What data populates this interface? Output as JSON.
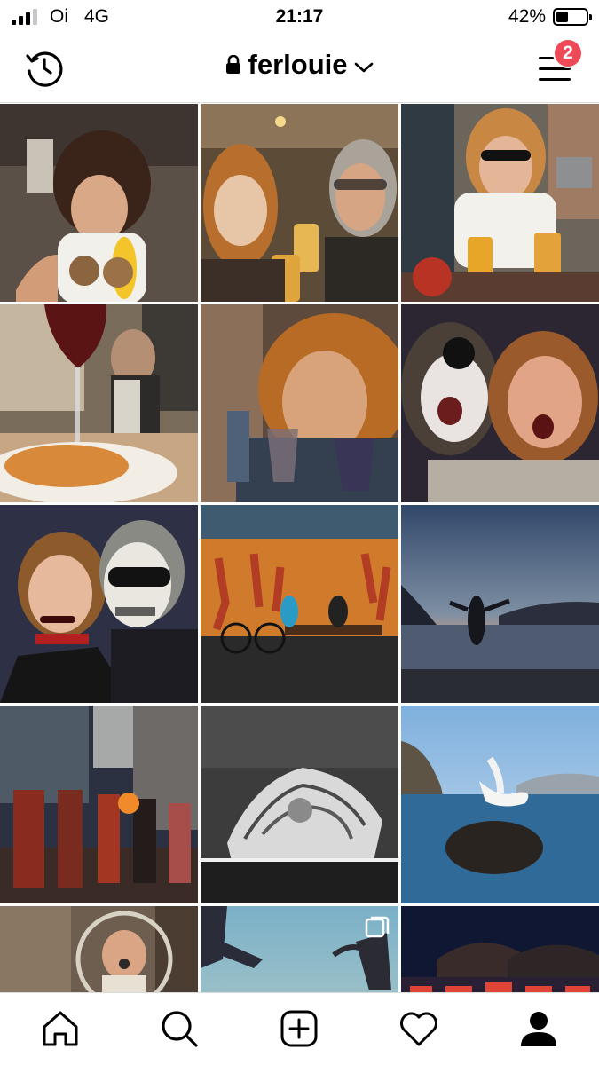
{
  "status_bar": {
    "carrier": "Oi",
    "network": "4G",
    "time": "21:17",
    "battery_text": "42%",
    "battery_level": 0.42,
    "signal_bars": 3
  },
  "header": {
    "username": "ferlouie",
    "notification_count": "2",
    "icons": [
      "history-icon",
      "lock-icon",
      "chevron-down-icon",
      "menu-icon"
    ]
  },
  "colors": {
    "badge": "#ed4956",
    "divider": "#dbdbdb"
  },
  "grid": {
    "posts": [
      {
        "name": "post-1-woman-holding-coconuts"
      },
      {
        "name": "post-2-couple-selfie-with-beer"
      },
      {
        "name": "post-3-woman-eating-with-drinks"
      },
      {
        "name": "post-4-wine-glass-and-food"
      },
      {
        "name": "post-5-woman-with-wine-glasses"
      },
      {
        "name": "post-6-halloween-skull-makeup-selfie"
      },
      {
        "name": "post-7-halloween-costume-couple"
      },
      {
        "name": "post-8-bicycle-orange-wall-mural"
      },
      {
        "name": "post-9-silhouette-at-sunset-beach"
      },
      {
        "name": "post-10-street-parade-performers"
      },
      {
        "name": "post-11-black-and-white-graffiti"
      },
      {
        "name": "post-12-seagull-on-rock"
      },
      {
        "name": "post-13-woman-in-wheel"
      },
      {
        "name": "post-14-jumping-silhouette-sky",
        "multiple": true
      },
      {
        "name": "post-15-circus-tent-at-night"
      }
    ]
  },
  "tabbar": {
    "tabs": [
      "home-icon",
      "search-icon",
      "add-post-icon",
      "heart-icon",
      "profile-icon"
    ]
  }
}
